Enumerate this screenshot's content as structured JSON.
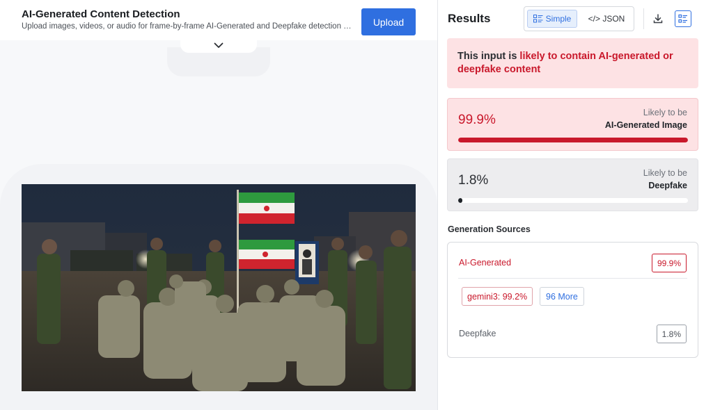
{
  "header": {
    "title": "AI-Generated Content Detection",
    "subtitle": "Upload images, videos, or audio for frame-by-frame AI-Generated and Deepfake detection with...",
    "upload_label": "Upload"
  },
  "preview": {
    "image_icon": "uploaded-image-preview"
  },
  "results": {
    "title": "Results",
    "view_toggle": {
      "simple_label": "Simple",
      "json_label": "</> JSON",
      "active": "Simple"
    },
    "alert": {
      "prefix": "This input is ",
      "highlight": "likely to contain AI-generated or deepfake content"
    },
    "ai_card": {
      "percent": "99.9%",
      "likely_label": "Likely to be",
      "type_label": "AI-Generated Image",
      "fill": 0.999
    },
    "deepfake_card": {
      "percent": "1.8%",
      "likely_label": "Likely to be",
      "type_label": "Deepfake",
      "fill": 0.018
    },
    "generation_sources": {
      "title": "Generation Sources",
      "ai_label": "AI-Generated",
      "ai_score": "99.9%",
      "top_source": "gemini3: 99.2%",
      "more_label": "96 More",
      "deepfake_label": "Deepfake",
      "deepfake_score": "1.8%"
    }
  },
  "colors": {
    "accent_blue": "#2f6fe0",
    "danger_red": "#c9182b",
    "alert_bg": "#fde2e4",
    "neutral_card_bg": "#ededef"
  }
}
